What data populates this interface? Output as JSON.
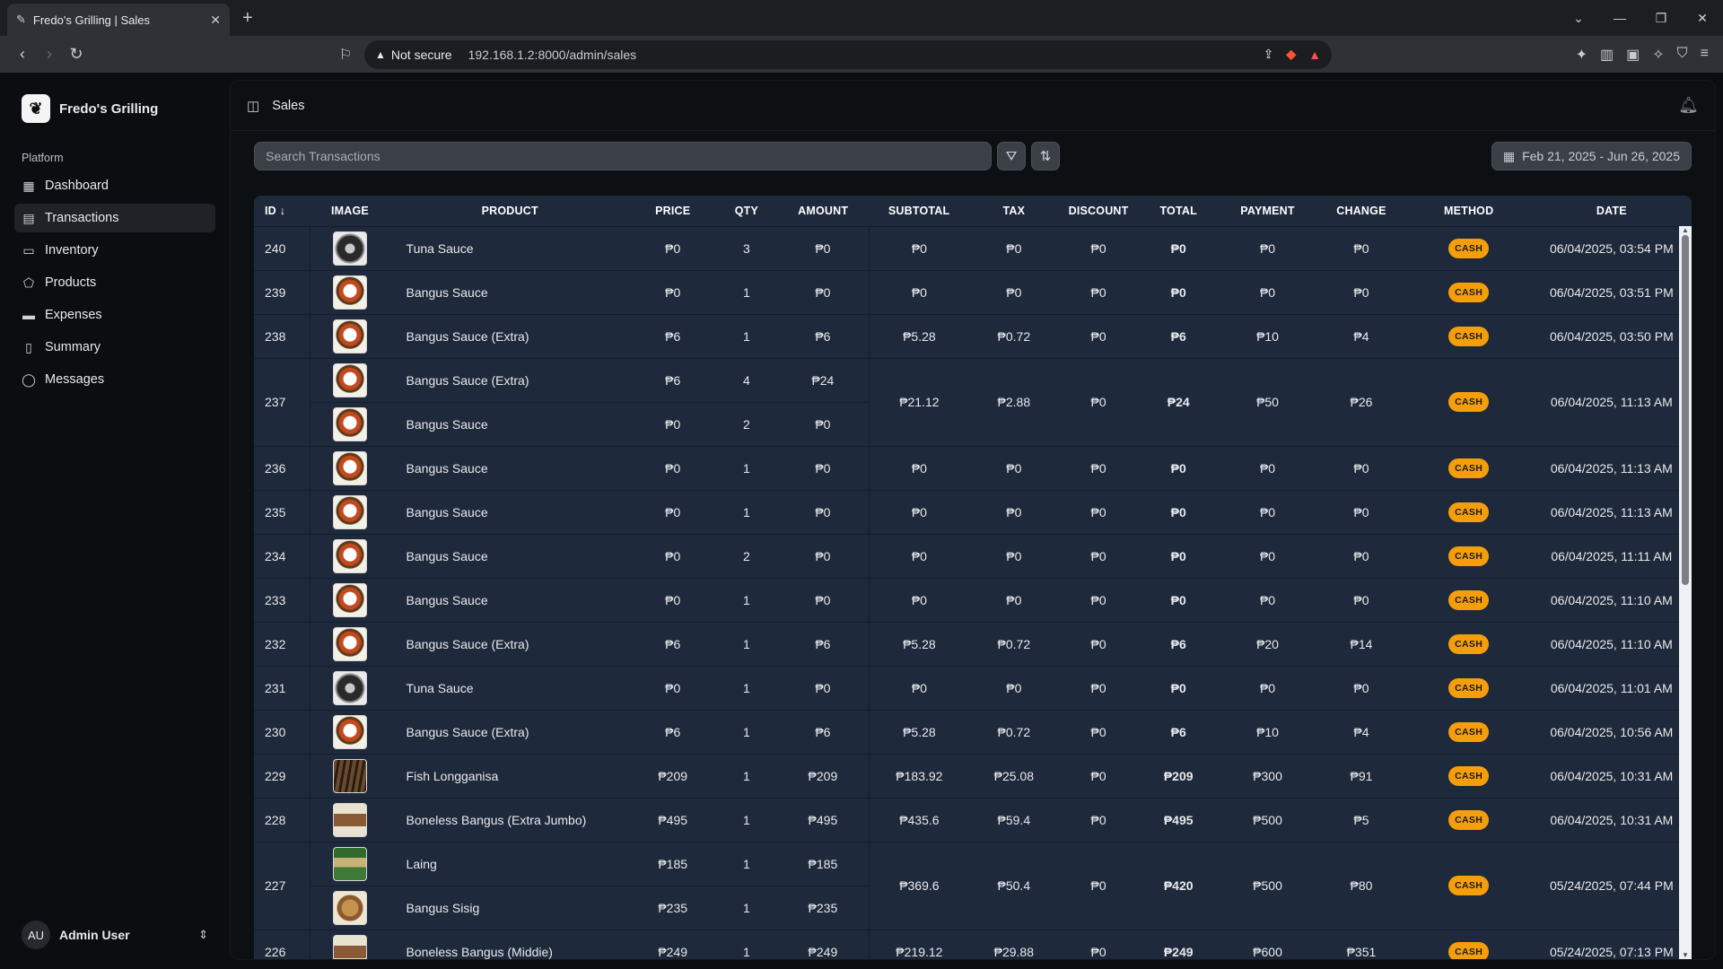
{
  "browser": {
    "tab_title": "Fredo's Grilling | Sales",
    "not_secure": "Not secure",
    "url": "192.168.1.2:8000/admin/sales"
  },
  "sidebar": {
    "brand": "Fredo's Grilling",
    "section": "Platform",
    "items": [
      {
        "label": "Dashboard",
        "icon": "dashboard-icon"
      },
      {
        "label": "Transactions",
        "icon": "receipt-icon"
      },
      {
        "label": "Inventory",
        "icon": "clipboard-icon"
      },
      {
        "label": "Products",
        "icon": "tag-icon"
      },
      {
        "label": "Expenses",
        "icon": "wallet-icon"
      },
      {
        "label": "Summary",
        "icon": "document-icon"
      },
      {
        "label": "Messages",
        "icon": "chat-icon"
      }
    ],
    "active": "Transactions",
    "user": {
      "initials": "AU",
      "name": "Admin User"
    }
  },
  "header": {
    "title": "Sales"
  },
  "toolbar": {
    "search_placeholder": "Search Transactions",
    "date_range": "Feb 21, 2025 - Jun 26, 2025"
  },
  "columns": [
    "ID",
    "IMAGE",
    "PRODUCT",
    "PRICE",
    "QTY",
    "AMOUNT",
    "SUBTOTAL",
    "TAX",
    "DISCOUNT",
    "TOTAL",
    "PAYMENT",
    "CHANGE",
    "METHOD",
    "DATE"
  ],
  "accent_color": "#f59e0b",
  "transactions": [
    {
      "id": "240",
      "items": [
        {
          "name": "Tuna Sauce",
          "img": "dark",
          "price": "₱0",
          "qty": "3",
          "amount": "₱0"
        }
      ],
      "subtotal": "₱0",
      "tax": "₱0",
      "discount": "₱0",
      "total": "₱0",
      "payment": "₱0",
      "change": "₱0",
      "method": "CASH",
      "date": "06/04/2025, 03:54 PM"
    },
    {
      "id": "239",
      "items": [
        {
          "name": "Bangus Sauce",
          "img": "plate",
          "price": "₱0",
          "qty": "1",
          "amount": "₱0"
        }
      ],
      "subtotal": "₱0",
      "tax": "₱0",
      "discount": "₱0",
      "total": "₱0",
      "payment": "₱0",
      "change": "₱0",
      "method": "CASH",
      "date": "06/04/2025, 03:51 PM"
    },
    {
      "id": "238",
      "items": [
        {
          "name": "Bangus Sauce (Extra)",
          "img": "plate",
          "price": "₱6",
          "qty": "1",
          "amount": "₱6"
        }
      ],
      "subtotal": "₱5.28",
      "tax": "₱0.72",
      "discount": "₱0",
      "total": "₱6",
      "payment": "₱10",
      "change": "₱4",
      "method": "CASH",
      "date": "06/04/2025, 03:50 PM"
    },
    {
      "id": "237",
      "items": [
        {
          "name": "Bangus Sauce (Extra)",
          "img": "plate",
          "price": "₱6",
          "qty": "4",
          "amount": "₱24"
        },
        {
          "name": "Bangus Sauce",
          "img": "plate",
          "price": "₱0",
          "qty": "2",
          "amount": "₱0"
        }
      ],
      "subtotal": "₱21.12",
      "tax": "₱2.88",
      "discount": "₱0",
      "total": "₱24",
      "payment": "₱50",
      "change": "₱26",
      "method": "CASH",
      "date": "06/04/2025, 11:13 AM"
    },
    {
      "id": "236",
      "items": [
        {
          "name": "Bangus Sauce",
          "img": "plate",
          "price": "₱0",
          "qty": "1",
          "amount": "₱0"
        }
      ],
      "subtotal": "₱0",
      "tax": "₱0",
      "discount": "₱0",
      "total": "₱0",
      "payment": "₱0",
      "change": "₱0",
      "method": "CASH",
      "date": "06/04/2025, 11:13 AM"
    },
    {
      "id": "235",
      "items": [
        {
          "name": "Bangus Sauce",
          "img": "plate",
          "price": "₱0",
          "qty": "1",
          "amount": "₱0"
        }
      ],
      "subtotal": "₱0",
      "tax": "₱0",
      "discount": "₱0",
      "total": "₱0",
      "payment": "₱0",
      "change": "₱0",
      "method": "CASH",
      "date": "06/04/2025, 11:13 AM"
    },
    {
      "id": "234",
      "items": [
        {
          "name": "Bangus Sauce",
          "img": "plate",
          "price": "₱0",
          "qty": "2",
          "amount": "₱0"
        }
      ],
      "subtotal": "₱0",
      "tax": "₱0",
      "discount": "₱0",
      "total": "₱0",
      "payment": "₱0",
      "change": "₱0",
      "method": "CASH",
      "date": "06/04/2025, 11:11 AM"
    },
    {
      "id": "233",
      "items": [
        {
          "name": "Bangus Sauce",
          "img": "plate",
          "price": "₱0",
          "qty": "1",
          "amount": "₱0"
        }
      ],
      "subtotal": "₱0",
      "tax": "₱0",
      "discount": "₱0",
      "total": "₱0",
      "payment": "₱0",
      "change": "₱0",
      "method": "CASH",
      "date": "06/04/2025, 11:10 AM"
    },
    {
      "id": "232",
      "items": [
        {
          "name": "Bangus Sauce (Extra)",
          "img": "plate",
          "price": "₱6",
          "qty": "1",
          "amount": "₱6"
        }
      ],
      "subtotal": "₱5.28",
      "tax": "₱0.72",
      "discount": "₱0",
      "total": "₱6",
      "payment": "₱20",
      "change": "₱14",
      "method": "CASH",
      "date": "06/04/2025, 11:10 AM"
    },
    {
      "id": "231",
      "items": [
        {
          "name": "Tuna Sauce",
          "img": "dark",
          "price": "₱0",
          "qty": "1",
          "amount": "₱0"
        }
      ],
      "subtotal": "₱0",
      "tax": "₱0",
      "discount": "₱0",
      "total": "₱0",
      "payment": "₱0",
      "change": "₱0",
      "method": "CASH",
      "date": "06/04/2025, 11:01 AM"
    },
    {
      "id": "230",
      "items": [
        {
          "name": "Bangus Sauce (Extra)",
          "img": "plate",
          "price": "₱6",
          "qty": "1",
          "amount": "₱6"
        }
      ],
      "subtotal": "₱5.28",
      "tax": "₱0.72",
      "discount": "₱0",
      "total": "₱6",
      "payment": "₱10",
      "change": "₱4",
      "method": "CASH",
      "date": "06/04/2025, 10:56 AM"
    },
    {
      "id": "229",
      "items": [
        {
          "name": "Fish Longganisa",
          "img": "grill",
          "price": "₱209",
          "qty": "1",
          "amount": "₱209"
        }
      ],
      "subtotal": "₱183.92",
      "tax": "₱25.08",
      "discount": "₱0",
      "total": "₱209",
      "payment": "₱300",
      "change": "₱91",
      "method": "CASH",
      "date": "06/04/2025, 10:31 AM"
    },
    {
      "id": "228",
      "items": [
        {
          "name": "Boneless Bangus (Extra Jumbo)",
          "img": "fish",
          "price": "₱495",
          "qty": "1",
          "amount": "₱495"
        }
      ],
      "subtotal": "₱435.6",
      "tax": "₱59.4",
      "discount": "₱0",
      "total": "₱495",
      "payment": "₱500",
      "change": "₱5",
      "method": "CASH",
      "date": "06/04/2025, 10:31 AM"
    },
    {
      "id": "227",
      "items": [
        {
          "name": "Laing",
          "img": "laing",
          "price": "₱185",
          "qty": "1",
          "amount": "₱185"
        },
        {
          "name": "Bangus Sisig",
          "img": "sisig",
          "price": "₱235",
          "qty": "1",
          "amount": "₱235"
        }
      ],
      "subtotal": "₱369.6",
      "tax": "₱50.4",
      "discount": "₱0",
      "total": "₱420",
      "payment": "₱500",
      "change": "₱80",
      "method": "CASH",
      "date": "05/24/2025, 07:44 PM"
    },
    {
      "id": "226",
      "items": [
        {
          "name": "Boneless Bangus (Middie)",
          "img": "fish",
          "price": "₱249",
          "qty": "1",
          "amount": "₱249"
        }
      ],
      "subtotal": "₱219.12",
      "tax": "₱29.88",
      "discount": "₱0",
      "total": "₱249",
      "payment": "₱600",
      "change": "₱351",
      "method": "CASH",
      "date": "05/24/2025, 07:13 PM"
    }
  ]
}
